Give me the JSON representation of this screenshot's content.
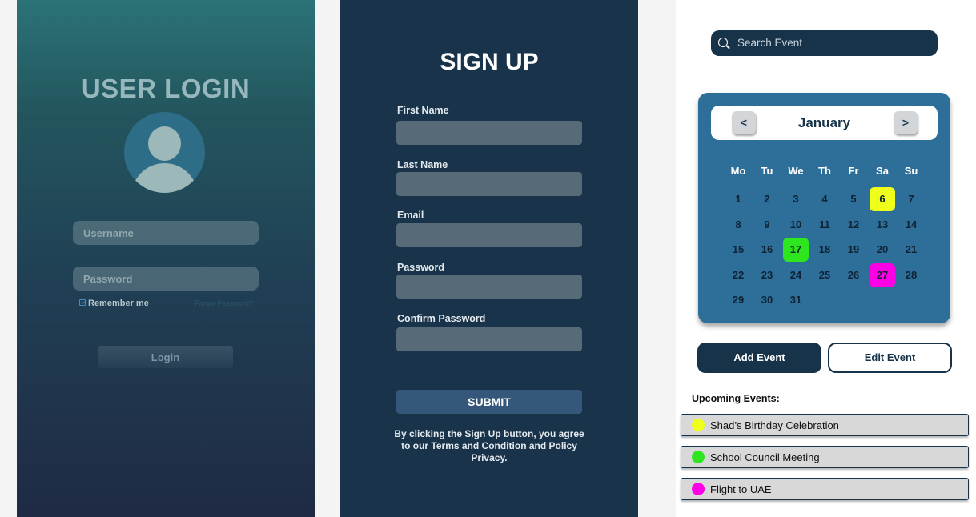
{
  "login": {
    "title": "USER LOGIN",
    "username_placeholder": "Username",
    "password_placeholder": "Password",
    "remember_label": "Remember me",
    "forgot_link": "Forgot Password?",
    "login_button": "Login"
  },
  "signup": {
    "title": "SIGN UP",
    "fields": [
      {
        "label": "First Name"
      },
      {
        "label": "Last Name"
      },
      {
        "label": "Email"
      },
      {
        "label": "Password"
      },
      {
        "label": "Confirm Password"
      }
    ],
    "submit_button": "SUBMIT",
    "terms": "By clicking the Sign Up button, you agree to our Terms and Condition and Policy Privacy."
  },
  "calendar": {
    "search_placeholder": "Search Event",
    "month": "January",
    "prev_label": "<",
    "next_label": ">",
    "weekdays": [
      "Mo",
      "Tu",
      "We",
      "Th",
      "Fr",
      "Sa",
      "Su"
    ],
    "days": [
      "1",
      "2",
      "3",
      "4",
      "5",
      "6",
      "7",
      "8",
      "9",
      "10",
      "11",
      "12",
      "13",
      "14",
      "15",
      "16",
      "17",
      "18",
      "19",
      "20",
      "21",
      "22",
      "23",
      "24",
      "25",
      "26",
      "27",
      "28",
      "29",
      "30",
      "31"
    ],
    "highlights": [
      {
        "day": "6",
        "color": "#f0ff1a"
      },
      {
        "day": "17",
        "color": "#2ee61e"
      },
      {
        "day": "27",
        "color": "#ff00e6"
      }
    ],
    "add_event_button": "Add Event",
    "edit_event_button": "Edit Event",
    "upcoming_heading": "Upcoming Events:",
    "events": [
      {
        "name": "Shad’s  Birthday Celebration",
        "color": "#f0ff1a"
      },
      {
        "name": "School Council Meeting",
        "color": "#2ee61e"
      },
      {
        "name": "Flight to UAE",
        "color": "#ff00e6"
      }
    ]
  }
}
